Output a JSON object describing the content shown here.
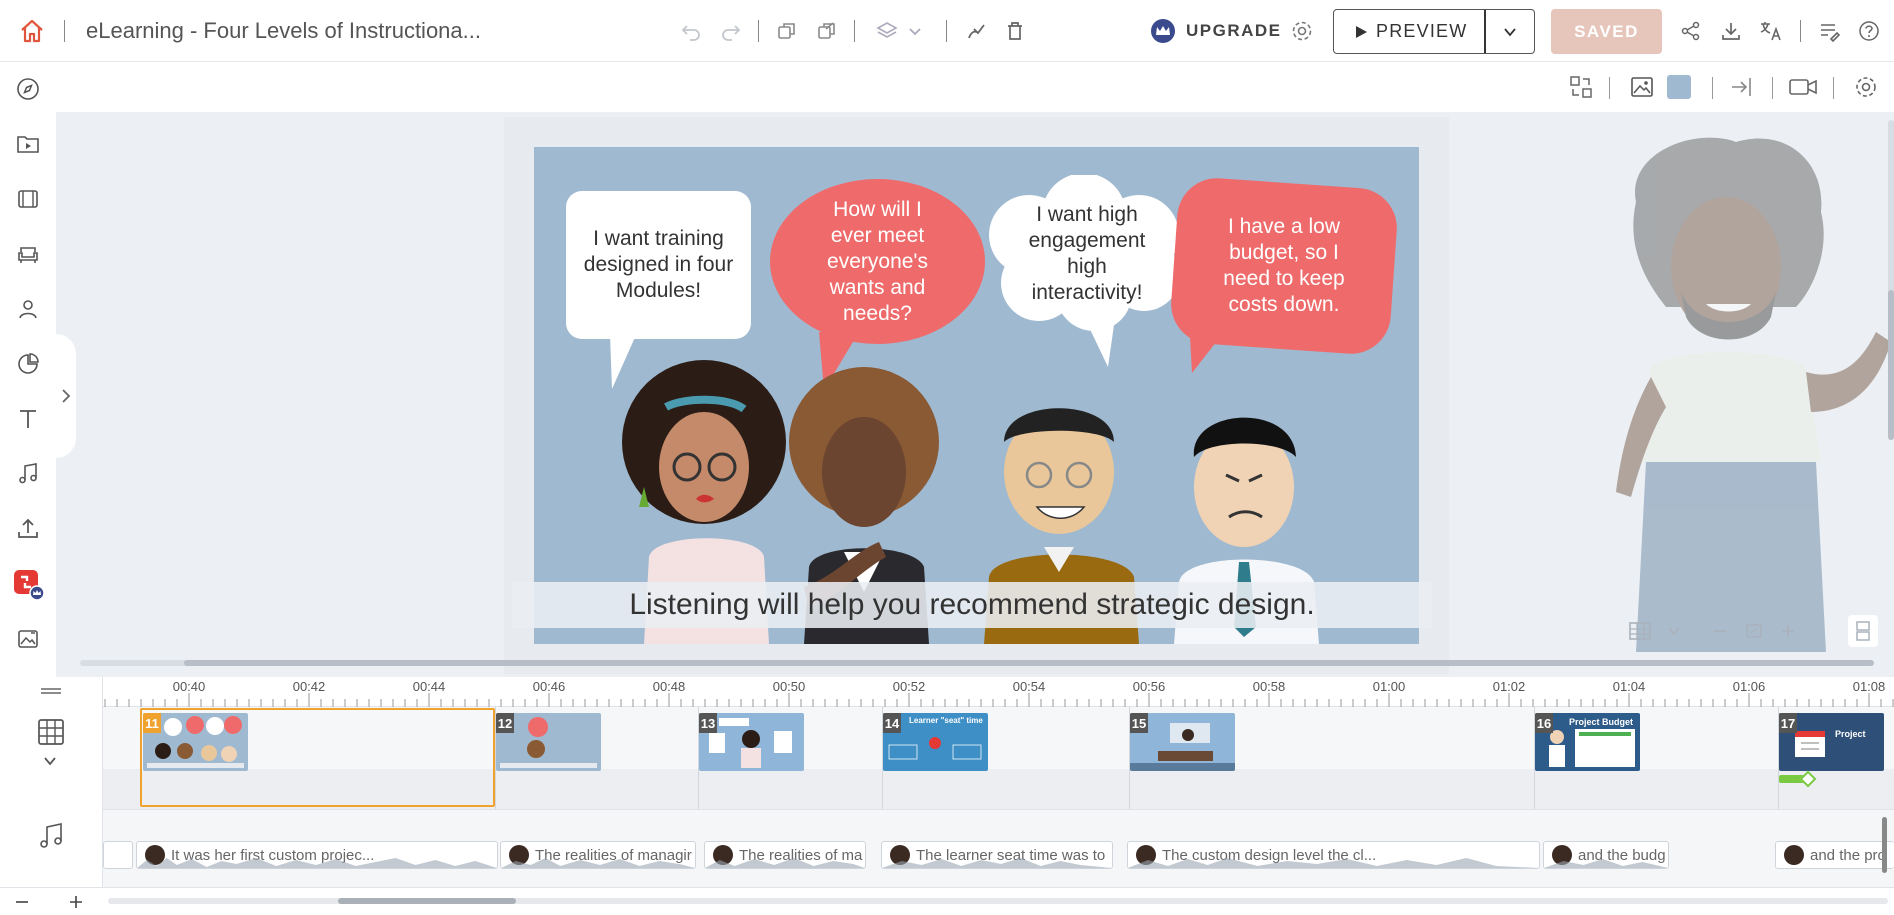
{
  "app": {
    "doc_title": "eLearning - Four Levels of Instructiona...",
    "upgrade_label": "UPGRADE",
    "preview_label": "PREVIEW",
    "saved_label": "SAVED"
  },
  "slide": {
    "bubbles": [
      "I want training designed in four Modules!",
      "How will I ever meet everyone's wants and needs?",
      "I want high engagement high interactivity!",
      "I have a low budget, so I need to keep costs down."
    ],
    "caption": "Listening will help you recommend strategic design."
  },
  "timeline": {
    "ruler": [
      "00:40",
      "00:42",
      "00:44",
      "00:46",
      "00:48",
      "00:50",
      "00:52",
      "00:54",
      "00:56",
      "00:58",
      "01:00",
      "01:02",
      "01:04",
      "01:06",
      "01:08"
    ],
    "scenes": [
      {
        "number": "11",
        "selected": true
      },
      {
        "number": "12"
      },
      {
        "number": "13"
      },
      {
        "number": "14",
        "thumb_title": "Learner \"seat\" time"
      },
      {
        "number": "15"
      },
      {
        "number": "16",
        "thumb_title": "Project Budget"
      },
      {
        "number": "17",
        "thumb_title": "Project"
      }
    ],
    "audio_clips": [
      "It was her first custom projec...",
      "The realities of managir",
      "The realities of ma",
      "The learner seat time was to",
      "The custom design level the cl...",
      "and the budg",
      "and the pro"
    ]
  },
  "colors": {
    "accent_orange": "#f0a22e",
    "saved_bg": "#e6c6bb",
    "slide_bg": "#9fb9d0",
    "bubble_red": "#ef6b6b"
  }
}
